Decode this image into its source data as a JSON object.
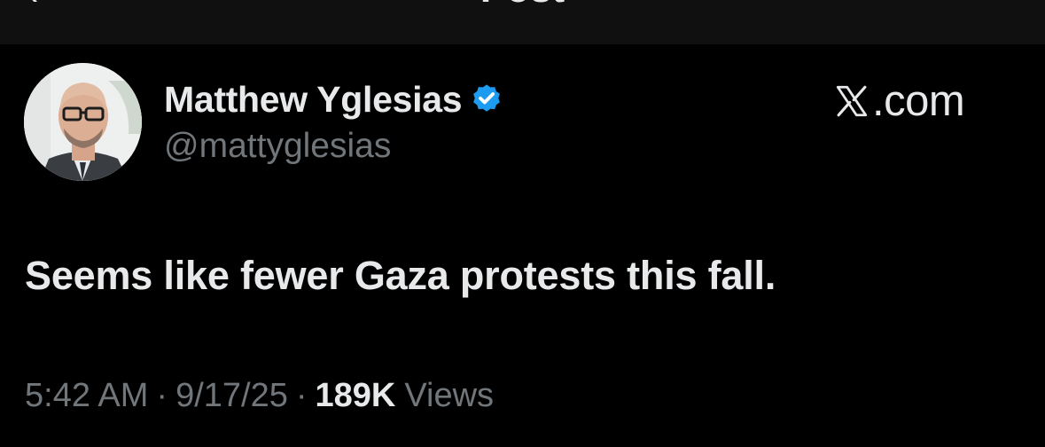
{
  "header": {
    "title": "Post",
    "back_icon": "chevron-left-icon"
  },
  "author": {
    "name": "Matthew Yglesias",
    "handle": "@mattyglesias",
    "verified_icon": "verified-badge-icon",
    "verified_color": "#1d9bf0"
  },
  "brand": {
    "icon": "x-logo-icon",
    "text": ".com"
  },
  "post": {
    "text": "Seems like fewer Gaza protests this fall."
  },
  "meta": {
    "time": "5:42 AM",
    "separator": "·",
    "date": "9/17/25",
    "views_count": "189K",
    "views_label": "Views"
  },
  "colors": {
    "background": "#000000",
    "header_background": "#101010",
    "primary_text": "#e7e9ea",
    "secondary_text": "#71767b",
    "accent": "#1d9bf0"
  }
}
